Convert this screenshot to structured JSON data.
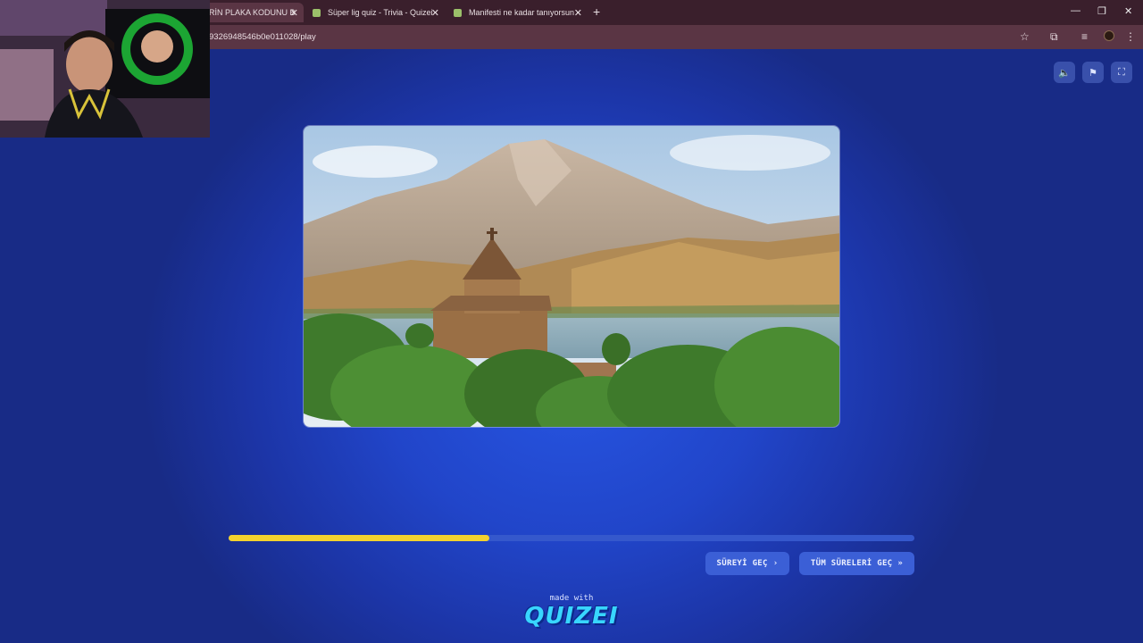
{
  "browser": {
    "tabs": [
      {
        "title": "RİN PLAKA KODUNU B",
        "close": "✕"
      },
      {
        "title": "Süper lig quiz - Trivia - Quizei",
        "close": "✕"
      },
      {
        "title": "Manifesti ne kadar tanıyorsun -",
        "close": "✕"
      }
    ],
    "new_tab": "+",
    "url": "9326948546b0e011028/play",
    "window_controls": [
      "—",
      "❐",
      "✕"
    ]
  },
  "quiz": {
    "controls": [
      {
        "name": "sound-icon",
        "glyph": "🔈"
      },
      {
        "name": "flag-icon",
        "glyph": "⚑"
      },
      {
        "name": "fullscreen-icon",
        "glyph": "⛶"
      }
    ],
    "progress": 0.38,
    "skip_label": "SÜREYİ GEÇ",
    "skip_icon": "›",
    "skip_all_label": "TÜM SÜRELERİ GEÇ",
    "skip_all_icon": "»"
  },
  "footer": {
    "made_with": "made with",
    "logo": "QUIZEI"
  },
  "colors": {
    "progress_fill": "#f3d22e",
    "page_bg": "#2145c9",
    "logo": "#38d6ff"
  }
}
